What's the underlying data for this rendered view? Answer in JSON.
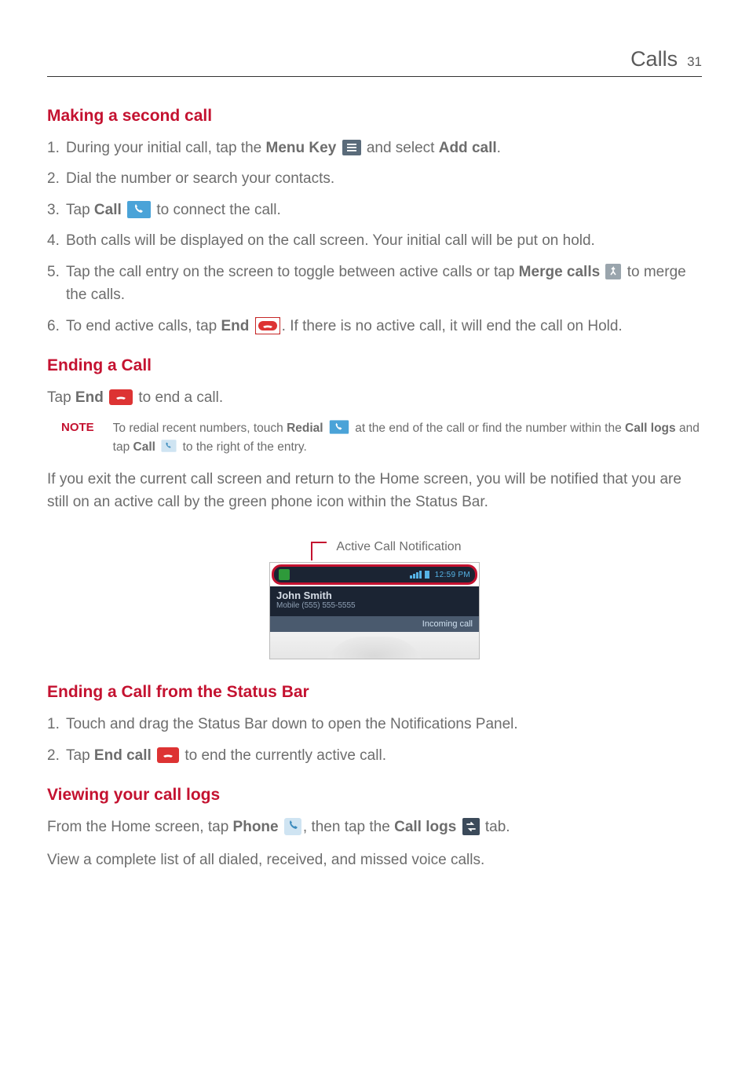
{
  "header": {
    "title": "Calls",
    "page_number": "31"
  },
  "sections": {
    "making_second_call": {
      "heading": "Making a second call",
      "steps": {
        "s1a": "1.",
        "s1b": "During your initial call, tap the ",
        "s1c": "Menu Key",
        "s1d": " and select ",
        "s1e": "Add call",
        "s1f": ".",
        "s2a": "2.",
        "s2b": "Dial the number or search your contacts.",
        "s3a": "3.",
        "s3b": "Tap ",
        "s3c": "Call",
        "s3d": " to connect the call.",
        "s4a": "4.",
        "s4b": "Both calls will be displayed on the call screen. Your initial call will be put on hold.",
        "s5a": "5.",
        "s5b": "Tap the call entry on the screen to toggle between active calls or tap ",
        "s5c": "Merge calls",
        "s5d": " to merge the calls.",
        "s6a": "6.",
        "s6b": "To end active calls, tap ",
        "s6c": "End",
        "s6d": ". If there is no active call, it will end the call on Hold."
      }
    },
    "ending_call": {
      "heading": "Ending a Call",
      "line1a": "Tap ",
      "line1b": "End",
      "line1c": " to end a call.",
      "note_label": "NOTE",
      "note_a": "To redial recent numbers, touch ",
      "note_b": "Redial",
      "note_c": " at the end of the call or find the number within the ",
      "note_d": "Call logs",
      "note_e": " and tap ",
      "note_f": "Call",
      "note_g": " to the right of the entry.",
      "para_after": "If you exit the current call screen and return to the Home screen, you will be notified that you are still on an active call by the green phone icon within the Status Bar."
    },
    "figure": {
      "caption": "Active Call Notification",
      "status_time": "12:59 PM",
      "caller_name": "John Smith",
      "caller_number": "Mobile (555) 555-5555",
      "incoming": "Incoming call"
    },
    "ending_call_status_bar": {
      "heading": "Ending a Call from the Status Bar",
      "steps": {
        "s1a": "1.",
        "s1b": "Touch and drag the Status Bar down to open the Notifications Panel.",
        "s2a": "2.",
        "s2b": "Tap ",
        "s2c": "End call",
        "s2d": " to end the currently active call."
      }
    },
    "viewing_call_logs": {
      "heading": "Viewing your call logs",
      "line1a": "From the Home screen, tap ",
      "line1b": "Phone",
      "line1c": ", then tap the ",
      "line1d": "Call logs",
      "line1e": " tab.",
      "line2": "View a complete list of all dialed, received, and missed voice calls."
    }
  }
}
